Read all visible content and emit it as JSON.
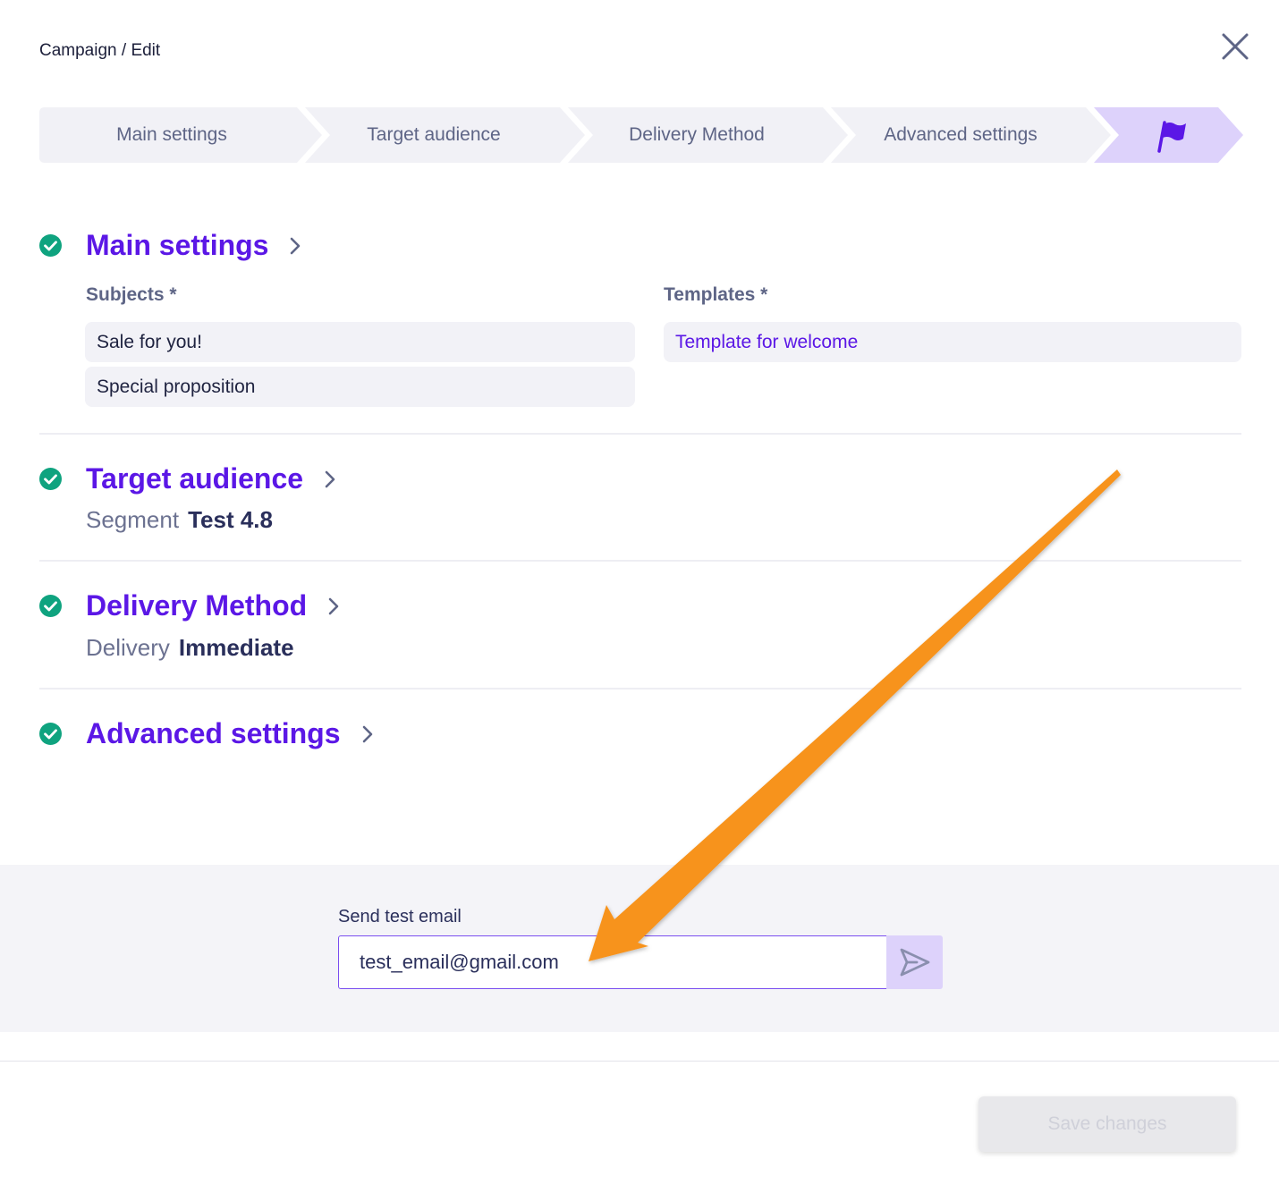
{
  "breadcrumb": "Campaign / Edit",
  "stepper": {
    "steps": [
      "Main settings",
      "Target audience",
      "Delivery Method",
      "Advanced settings"
    ],
    "final_icon": "flag-icon"
  },
  "sections": {
    "main": {
      "title": "Main settings",
      "subjects_label": "Subjects *",
      "subjects": [
        "Sale for you!",
        "Special proposition"
      ],
      "templates_label": "Templates *",
      "templates": [
        "Template for welcome"
      ]
    },
    "audience": {
      "title": "Target audience",
      "key": "Segment",
      "value": "Test 4.8"
    },
    "delivery": {
      "title": "Delivery Method",
      "key": "Delivery",
      "value": "Immediate"
    },
    "advanced": {
      "title": "Advanced settings"
    }
  },
  "test_email": {
    "label": "Send test email",
    "value": "test_email@gmail.com"
  },
  "save_button": "Save changes",
  "colors": {
    "accent": "#5b17e6",
    "success": "#0fa37f",
    "annotation_arrow": "#f7931e"
  }
}
